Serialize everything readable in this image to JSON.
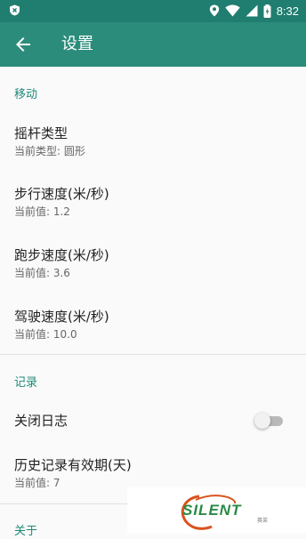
{
  "status_bar": {
    "time": "8:32",
    "left_icon": "shield-x-icon",
    "icons": [
      "location-icon",
      "wifi-icon",
      "signal-icon",
      "battery-icon"
    ]
  },
  "app_bar": {
    "title": "设置",
    "back_icon": "arrow-back-icon"
  },
  "sections": [
    {
      "header": "移动"
    },
    {
      "header": "记录"
    },
    {
      "header": "关于"
    }
  ],
  "items": [
    {
      "title": "摇杆类型",
      "summary": "当前类型: 圆形"
    },
    {
      "title": "步行速度(米/秒)",
      "summary": "当前值: 1.2"
    },
    {
      "title": "跑步速度(米/秒)",
      "summary": "当前值: 3.6"
    },
    {
      "title": "驾驶速度(米/秒)",
      "summary": "当前值: 10.0"
    },
    {
      "title": "关闭日志",
      "summary": "",
      "toggle": false
    },
    {
      "title": "历史记录有效期(天)",
      "summary": "当前值: 7"
    }
  ],
  "watermark": {
    "text": "SILENT",
    "subtext": "赛莱"
  },
  "colors": {
    "status_bar": "#1f7e6f",
    "app_bar": "#2c8c7b",
    "accent": "#1f8a78"
  }
}
